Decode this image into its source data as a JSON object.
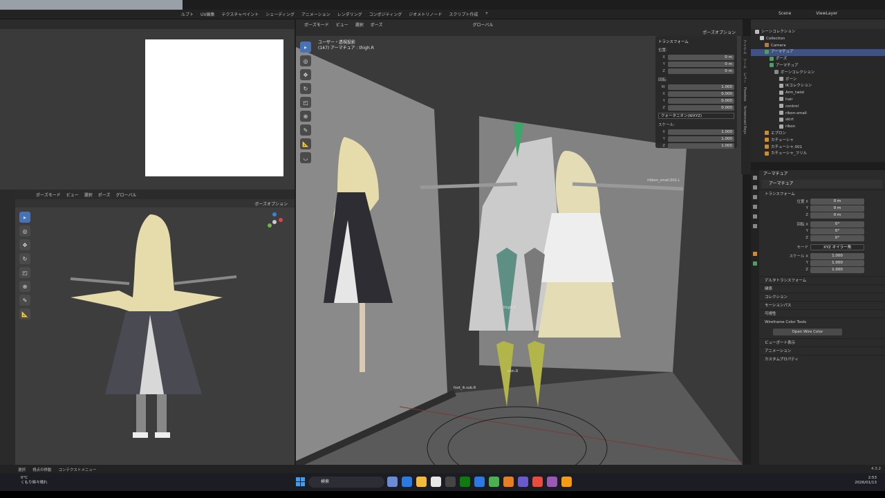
{
  "topbar": {
    "menu": [
      "ルプト",
      "UV編集",
      "テクスチャペイント",
      "シェーディング",
      "アニメーション",
      "レンダリング",
      "コンポジティング",
      "ジオメトリノード",
      "スクリプト作成",
      "+"
    ],
    "scene": "Scene",
    "view_layer": "ViewLayer"
  },
  "left_viewport": {
    "mode": "ポーズモード",
    "menu": [
      "ビュー",
      "選択",
      "ポーズ"
    ],
    "pivot": "グローバル",
    "options": "ポーズオプション"
  },
  "main_viewport": {
    "mode": "ポーズモード",
    "menu": [
      "ビュー",
      "選択",
      "ポーズ"
    ],
    "pivot": "グローバル",
    "options": "ポーズオプション",
    "info_line1": "ユーザー・透視投影",
    "info_line2": "(147) アーマチュア : thigh.R",
    "bone_labels": [
      "thigh.R",
      "shin.R",
      "foot_ik.sub.R",
      "ribbon_small.002.L"
    ]
  },
  "n_panel": {
    "section": "トランスフォーム",
    "location_label": "位置:",
    "location": [
      {
        "axis": "X",
        "value": "0 m"
      },
      {
        "axis": "Y",
        "value": "0 m"
      },
      {
        "axis": "Z",
        "value": "0 m"
      }
    ],
    "rotation_label": "回転:",
    "rotation": [
      {
        "axis": "W",
        "value": "1.000"
      },
      {
        "axis": "X",
        "value": "0.000"
      },
      {
        "axis": "Y",
        "value": "0.000"
      },
      {
        "axis": "Z",
        "value": "0.000"
      }
    ],
    "rotation_mode": "クォータニオン(WXYZ)",
    "scale_label": "スケール:",
    "scale": [
      {
        "axis": "X",
        "value": "1.000"
      },
      {
        "axis": "Y",
        "value": "1.000"
      },
      {
        "axis": "Z",
        "value": "1.000"
      }
    ],
    "tabs": [
      "アイテム",
      "ツール",
      "ビュー",
      "Posebox",
      "Screencast Keys"
    ]
  },
  "outliner": {
    "search_placeholder": "",
    "rows": [
      {
        "label": "シーンコレクション",
        "indent": 0,
        "color": "#bbbbbb",
        "selected": false
      },
      {
        "label": "Collection",
        "indent": 1,
        "color": "#cccccc",
        "selected": false
      },
      {
        "label": "Camera",
        "indent": 2,
        "color": "#b07d48",
        "selected": false
      },
      {
        "label": "アーマチュア",
        "indent": 2,
        "color": "#4fa060",
        "selected": true
      },
      {
        "label": "ポーズ",
        "indent": 3,
        "color": "#4fa060",
        "selected": false
      },
      {
        "label": "アーマチュア",
        "indent": 3,
        "color": "#4fa060",
        "selected": false
      },
      {
        "label": "ボーンコレクション",
        "indent": 4,
        "color": "#888888",
        "selected": false
      },
      {
        "label": "ボーン",
        "indent": 5,
        "color": "#aaaaaa",
        "selected": false
      },
      {
        "label": "IKコレクション",
        "indent": 5,
        "color": "#aaaaaa",
        "selected": false
      },
      {
        "label": "Arm_twist",
        "indent": 5,
        "color": "#aaaaaa",
        "selected": false
      },
      {
        "label": "hair",
        "indent": 5,
        "color": "#aaaaaa",
        "selected": false
      },
      {
        "label": "control",
        "indent": 5,
        "color": "#aaaaaa",
        "selected": false
      },
      {
        "label": "ribon-small",
        "indent": 5,
        "color": "#aaaaaa",
        "selected": false
      },
      {
        "label": "skirt",
        "indent": 5,
        "color": "#aaaaaa",
        "selected": false
      },
      {
        "label": "ribon",
        "indent": 5,
        "color": "#aaaaaa",
        "selected": false
      },
      {
        "label": "エプロン",
        "indent": 2,
        "color": "#d08a30",
        "selected": false
      },
      {
        "label": "カチューシャ",
        "indent": 2,
        "color": "#d08a30",
        "selected": false
      },
      {
        "label": "カチューシャ.001",
        "indent": 2,
        "color": "#d08a30",
        "selected": false
      },
      {
        "label": "カチューシャ_フリル",
        "indent": 2,
        "color": "#d08a30",
        "selected": false
      }
    ]
  },
  "properties": {
    "object_name": "アーマチュア",
    "data_name": "アーマチュア",
    "transform_section": "トランスフォーム",
    "location": [
      {
        "label": "位置 X",
        "value": "0 m"
      },
      {
        "label": "Y",
        "value": "0 m"
      },
      {
        "label": "Z",
        "value": "0 m"
      }
    ],
    "rotation": [
      {
        "label": "回転 X",
        "value": "0°"
      },
      {
        "label": "Y",
        "value": "0°"
      },
      {
        "label": "Z",
        "value": "0°"
      }
    ],
    "mode_label": "モード",
    "mode_value": "XYZ オイラー角",
    "scale": [
      {
        "label": "スケール X",
        "value": "1.000"
      },
      {
        "label": "Y",
        "value": "1.000"
      },
      {
        "label": "Z",
        "value": "1.000"
      }
    ],
    "sections": [
      "デルタトランスフォーム",
      "関係",
      "コレクション",
      "モーションパス",
      "可視性",
      "Wireframe Color Tools"
    ],
    "wire_button": "Open Wire Color",
    "sections2": [
      "ビューポート表示",
      "アニメーション",
      "カスタムプロパティ"
    ]
  },
  "statusbar": {
    "items": [
      "選択",
      "視点の移動",
      "コンテクストメニュー"
    ],
    "version": "4.3.2"
  },
  "taskbar": {
    "temperature": "0°C",
    "weather": "くもり時々晴れ",
    "search": "検索",
    "time": "2:53",
    "date": "2026/01/13",
    "app_colors": [
      "#6b8bd6",
      "#2a7ae2",
      "#f3b93a",
      "#e6e6e6",
      "#444",
      "#0f7b0f",
      "#2a7ae2",
      "#4caf50",
      "#e67e22",
      "#6a5acd",
      "#e74c3c",
      "#9b59b6",
      "#f39c12"
    ]
  }
}
